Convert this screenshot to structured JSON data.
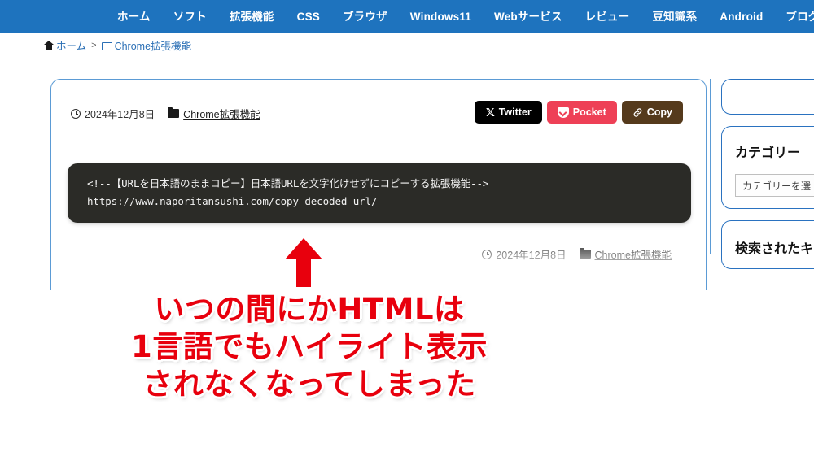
{
  "nav": {
    "items": [
      {
        "label": "ホーム"
      },
      {
        "label": "ソフト"
      },
      {
        "label": "拡張機能"
      },
      {
        "label": "CSS"
      },
      {
        "label": "ブラウザ"
      },
      {
        "label": "Windows11"
      },
      {
        "label": "Webサービス"
      },
      {
        "label": "レビュー"
      },
      {
        "label": "豆知識系"
      },
      {
        "label": "Android"
      },
      {
        "label": "ブログ"
      }
    ],
    "background_color": "#1e73be",
    "text_color": "#ffffff"
  },
  "breadcrumb": {
    "home_label": "ホーム",
    "separator": ">",
    "current_label": "Chrome拡張機能",
    "link_color": "#2a6fb5"
  },
  "article": {
    "meta": {
      "date": "2024年12月8日",
      "category": "Chrome拡張機能"
    },
    "share_buttons": [
      {
        "label": "Twitter",
        "icon": "x-twitter-icon",
        "color": "#000000"
      },
      {
        "label": "Pocket",
        "icon": "pocket-icon",
        "color": "#ee4056"
      },
      {
        "label": "Copy",
        "icon": "link-icon",
        "color": "#553a1c"
      }
    ],
    "code_block": {
      "background_color": "#2b2b27",
      "text_color": "#f2f2f2",
      "line1": "<!--【URLを日本語のままコピー】日本語URLを文字化けせずにコピーする拡張機能-->",
      "line2": "https://www.naporitansushi.com/copy-decoded-url/"
    },
    "meta2": {
      "date": "2024年12月8日",
      "category": "Chrome拡張機能"
    }
  },
  "sidebar": {
    "search_box": {
      "value": "",
      "placeholder": ""
    },
    "category_box": {
      "title": "カテゴリー",
      "select_value": "カテゴリーを選"
    },
    "third_box": {
      "title": "検索されたキ"
    },
    "border_color": "#2a72c0"
  },
  "annotation": {
    "arrow_color": "#e8000d",
    "text_color": "#e8000d",
    "line1": "いつの間にかHTMLは",
    "line2": "1言語でもハイライト表示",
    "line3": "されなくなってしまった"
  }
}
